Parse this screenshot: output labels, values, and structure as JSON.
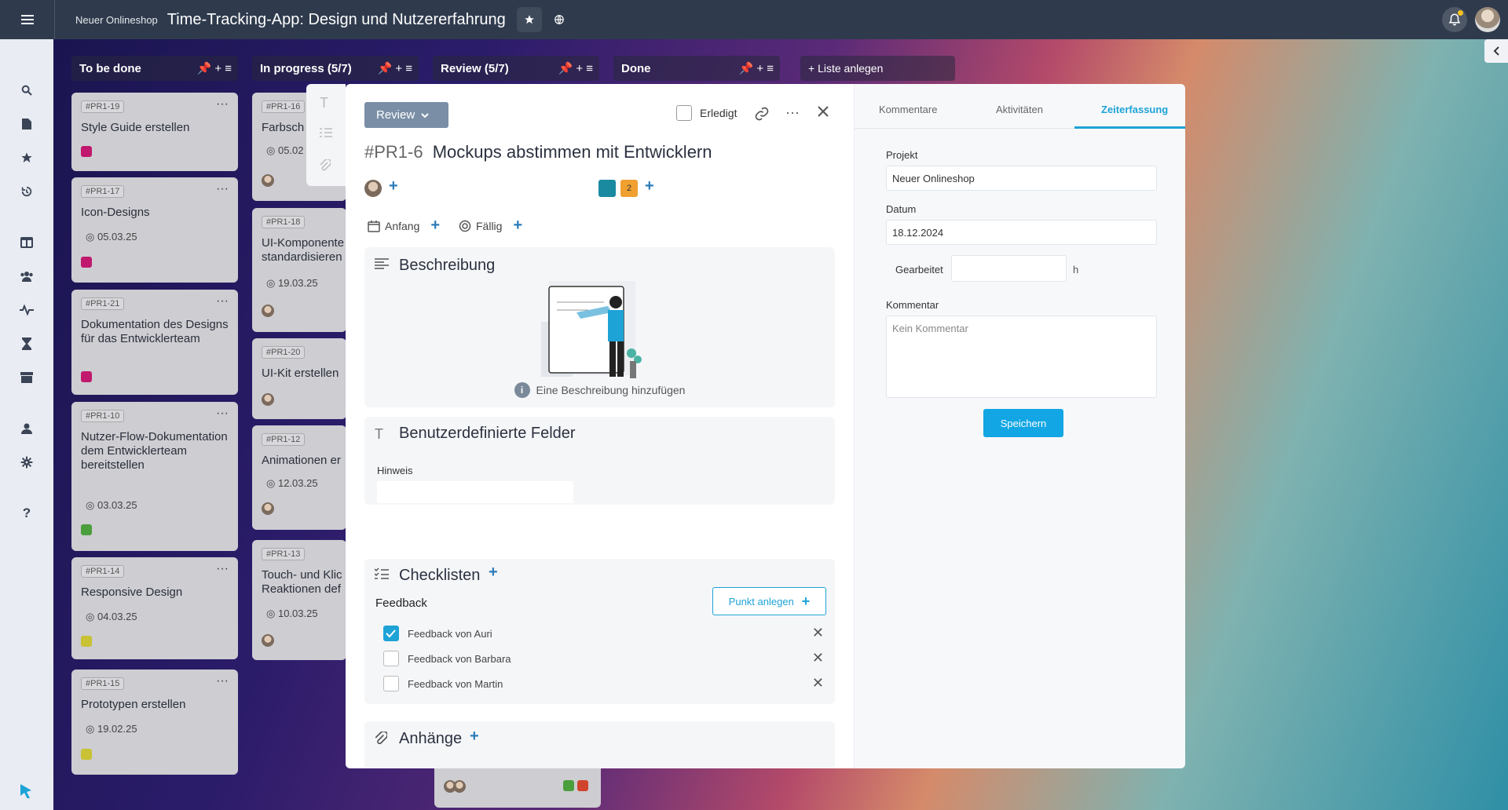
{
  "topbar": {
    "project": "Neuer Onlineshop",
    "title": "Time-Tracking-App: Design und Nutzererfahrung"
  },
  "columns": [
    {
      "name": "To be done"
    },
    {
      "name": "In progress  (5/7)"
    },
    {
      "name": "Review  (5/7)"
    },
    {
      "name": "Done"
    }
  ],
  "add_list": "Liste anlegen",
  "cards_col1": [
    {
      "id": "#PR1-19",
      "title": "Style Guide erstellen",
      "date": "",
      "color": "#c0196e"
    },
    {
      "id": "#PR1-17",
      "title": "Icon-Designs",
      "date": "05.03.25",
      "color": "#c0196e"
    },
    {
      "id": "#PR1-21",
      "title": "Dokumentation des Designs für das Entwicklerteam",
      "date": "",
      "color": "#c0196e"
    },
    {
      "id": "#PR1-10",
      "title": "Nutzer-Flow-Dokumentation dem Entwicklerteam bereitstellen",
      "date": "03.03.25",
      "color": "#4a9e3c"
    },
    {
      "id": "#PR1-14",
      "title": "Responsive Design",
      "date": "04.03.25",
      "color": "#c8c234"
    },
    {
      "id": "#PR1-15",
      "title": "Prototypen erstellen",
      "date": "19.02.25",
      "color": "#c8c234"
    }
  ],
  "cards_col2": [
    {
      "id": "#PR1-16",
      "title": "Farbsch",
      "date": "05.02"
    },
    {
      "id": "#PR1-18",
      "title": "UI-Komponente standardisieren",
      "date": "19.03.25"
    },
    {
      "id": "#PR1-20",
      "title": "UI-Kit erstellen",
      "date": ""
    },
    {
      "id": "#PR1-12",
      "title": "Animationen er",
      "date": "12.03.25"
    },
    {
      "id": "#PR1-13",
      "title": "Touch- und Klic Reaktionen def",
      "date": "10.03.25"
    }
  ],
  "modal": {
    "status": "Review",
    "done_label": "Erledigt",
    "task_id": "#PR1-6",
    "task_title": "Mockups abstimmen mit Entwicklern",
    "label_count": "2",
    "start_label": "Anfang",
    "due_label": "Fällig",
    "description_title": "Beschreibung",
    "description_hint": "Eine Beschreibung hinzufügen",
    "custom_fields_title": "Benutzerdefinierte Felder",
    "hint_label": "Hinweis",
    "checklists_title": "Checklisten",
    "checklist_name": "Feedback",
    "add_point": "Punkt anlegen",
    "checklist_items": [
      {
        "text": "Feedback von Auri",
        "checked": true
      },
      {
        "text": "Feedback von Barbara",
        "checked": false
      },
      {
        "text": "Feedback von Martin",
        "checked": false
      }
    ],
    "attachments_title": "Anhänge"
  },
  "right_panel": {
    "tabs": [
      "Kommentare",
      "Aktivitäten",
      "Zeiterfassung"
    ],
    "active_tab": "Zeiterfassung",
    "project_label": "Projekt",
    "project_value": "Neuer Onlineshop",
    "date_label": "Datum",
    "date_value": "18.12.2024",
    "worked_label": "Gearbeitet",
    "worked_unit": "h",
    "comment_label": "Kommentar",
    "comment_placeholder": "Kein Kommentar",
    "save_label": "Speichern"
  },
  "colors": {
    "accent": "#1ea3d6",
    "teal_label": "#1a8aa0",
    "orange_label": "#f0a030"
  }
}
